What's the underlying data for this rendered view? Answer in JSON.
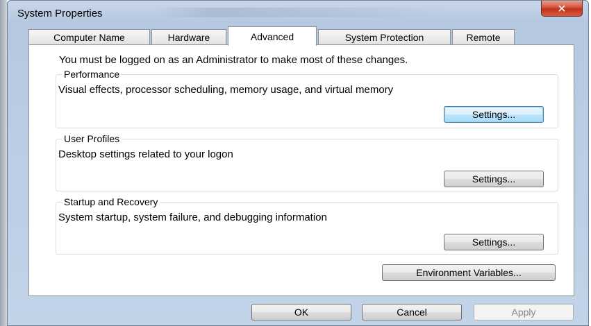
{
  "window": {
    "title": "System Properties",
    "close_glyph": "✕"
  },
  "tabs": [
    {
      "label": "Computer Name",
      "active": false
    },
    {
      "label": "Hardware",
      "active": false
    },
    {
      "label": "Advanced",
      "active": true
    },
    {
      "label": "System Protection",
      "active": false
    },
    {
      "label": "Remote",
      "active": false
    }
  ],
  "panel": {
    "notice": "You must be logged on as an Administrator to make most of these changes.",
    "performance": {
      "title": "Performance",
      "description": "Visual effects, processor scheduling, memory usage, and virtual memory",
      "settings_label": "Settings..."
    },
    "user_profiles": {
      "title": "User Profiles",
      "description": "Desktop settings related to your logon",
      "settings_label": "Settings..."
    },
    "startup_recovery": {
      "title": "Startup and Recovery",
      "description": "System startup, system failure, and debugging information",
      "settings_label": "Settings..."
    },
    "environment_variables_label": "Environment Variables..."
  },
  "footer": {
    "ok_label": "OK",
    "cancel_label": "Cancel",
    "apply_label": "Apply"
  }
}
